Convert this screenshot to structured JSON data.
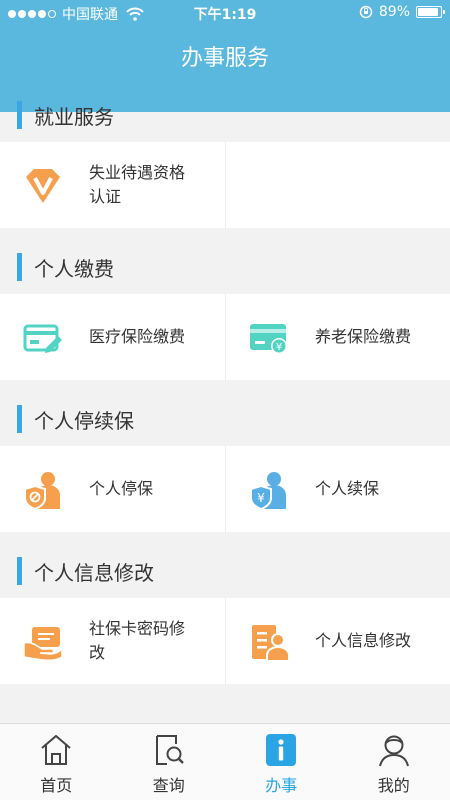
{
  "status_bar": {
    "carrier": "中国联通",
    "time": "下午1:19",
    "battery": "89%",
    "battery_level": 0.89,
    "signal_dots": 5,
    "signal_filled": 4
  },
  "header": {
    "title": "办事服务"
  },
  "sections": [
    {
      "title": "就业服务",
      "items": [
        {
          "label": "失业待遇资格认证",
          "icon": "diamond-v-icon"
        }
      ]
    },
    {
      "title": "个人缴费",
      "items": [
        {
          "label": "医疗保险缴费",
          "icon": "card-pen-icon"
        },
        {
          "label": "养老保险缴费",
          "icon": "card-yuan-icon"
        }
      ]
    },
    {
      "title": "个人停续保",
      "items": [
        {
          "label": "个人停保",
          "icon": "person-stop-shield-icon"
        },
        {
          "label": "个人续保",
          "icon": "person-yuan-shield-icon"
        }
      ]
    },
    {
      "title": "个人信息修改",
      "items": [
        {
          "label": "社保卡密码修改",
          "icon": "hand-card-icon"
        },
        {
          "label": "个人信息修改",
          "icon": "document-person-icon"
        }
      ]
    }
  ],
  "tab_bar": {
    "tabs": [
      {
        "label": "首页",
        "icon": "home-icon"
      },
      {
        "label": "查询",
        "icon": "search-document-icon"
      },
      {
        "label": "办事",
        "icon": "info-icon",
        "active": true
      },
      {
        "label": "我的",
        "icon": "user-icon"
      }
    ]
  },
  "colors": {
    "header": "#5ab7de",
    "accent": "#3aa7e2",
    "orange": "#f6a04d",
    "teal": "#52d3c4",
    "blue": "#59aee6",
    "background": "#f2f2f2"
  }
}
